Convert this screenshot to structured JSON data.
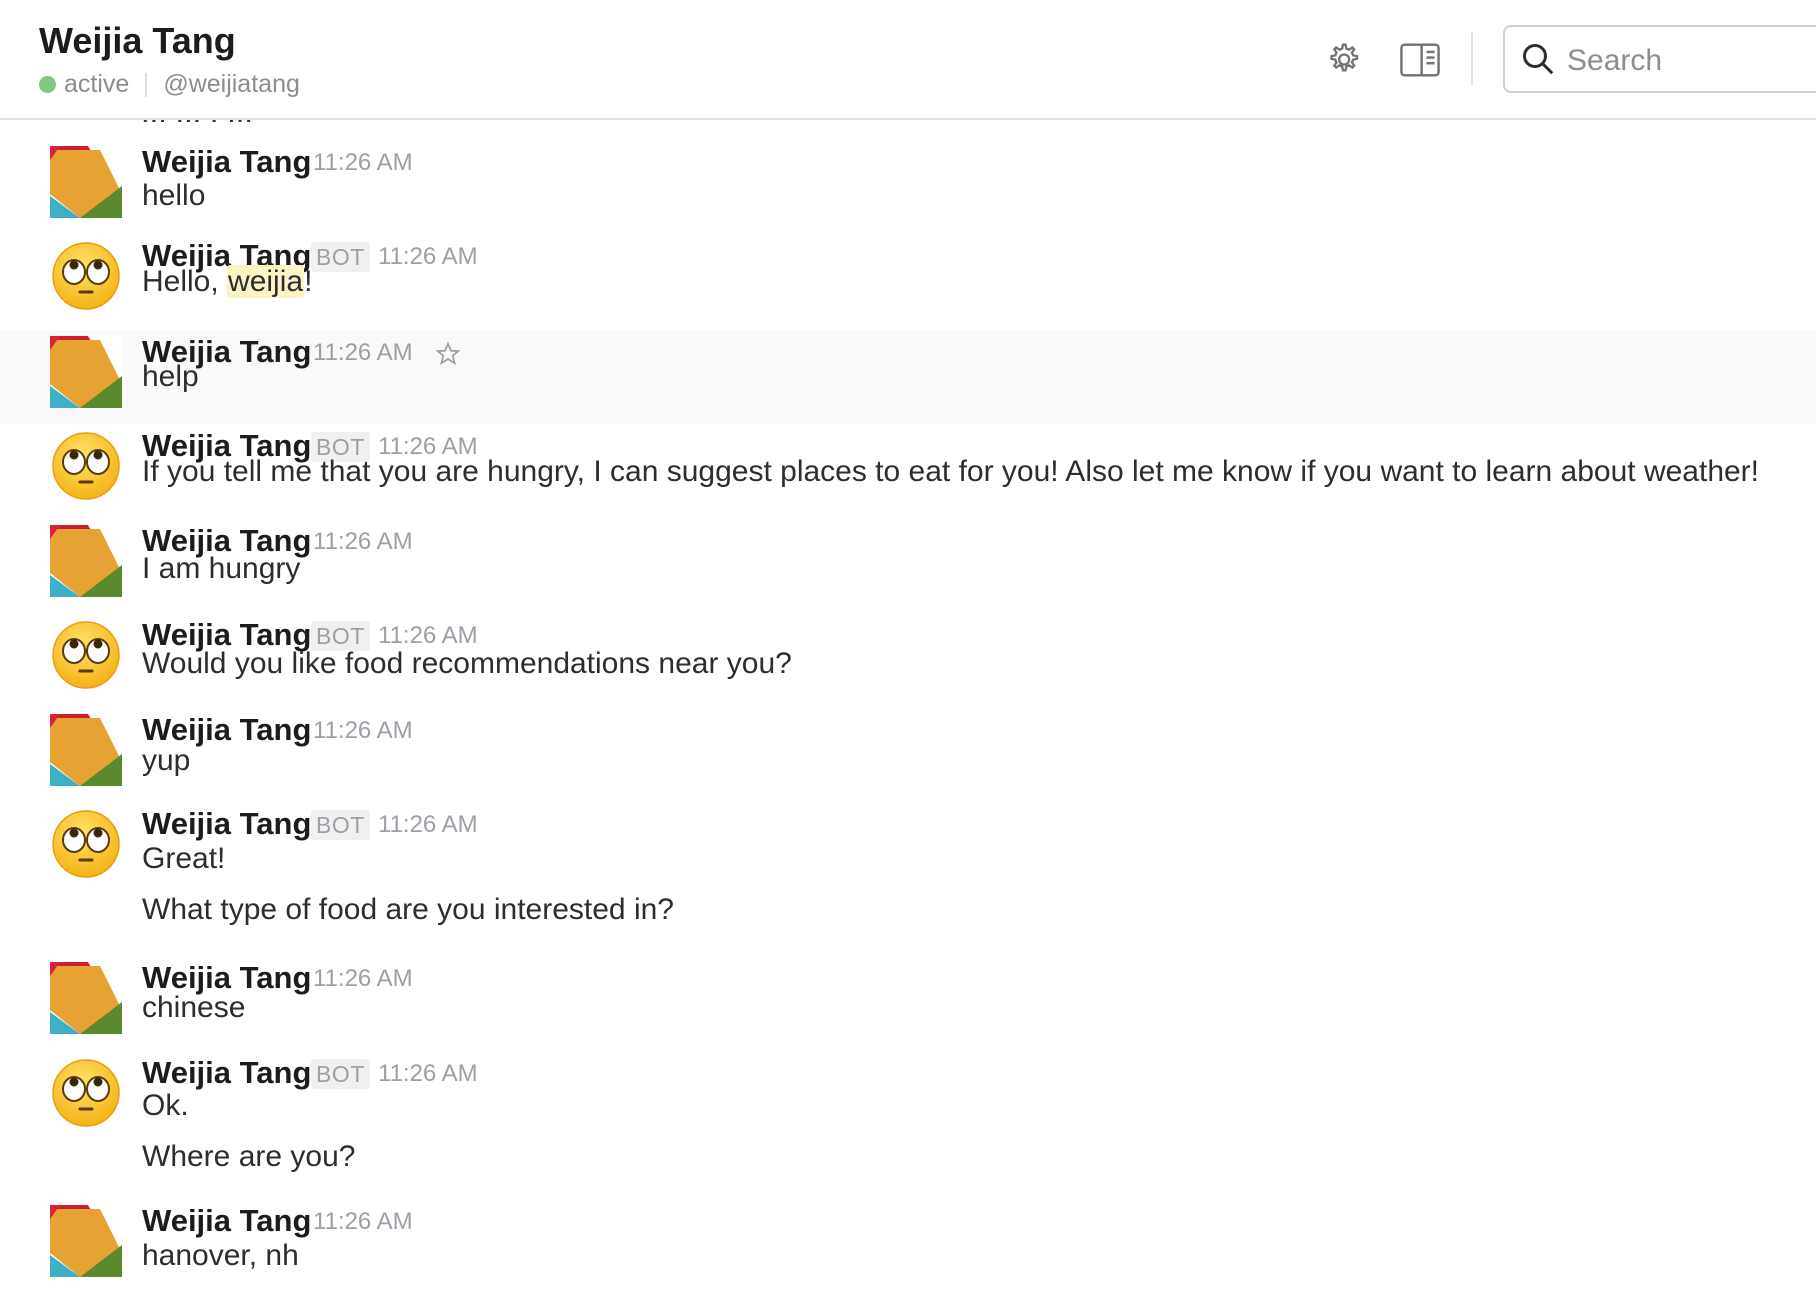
{
  "header": {
    "title": "Weijia Tang",
    "status": "active",
    "handle": "@weijiatang",
    "search_placeholder": "Search",
    "icons": [
      "gear-icon",
      "sidebar-toggle-icon",
      "search-icon"
    ]
  },
  "clipped_text": "... ... . ...",
  "messages": [
    {
      "author": "Weijia Tang",
      "bot": false,
      "time": "11:26 AM",
      "lines": [
        "hello"
      ]
    },
    {
      "author": "Weijia Tang",
      "bot": true,
      "badge": "BOT",
      "time": "11:26 AM",
      "pre": "Hello, ",
      "mention": "weijia",
      "post": "!"
    },
    {
      "author": "Weijia Tang",
      "bot": false,
      "time": "11:26 AM",
      "lines": [
        "help"
      ],
      "hovered": true
    },
    {
      "author": "Weijia Tang",
      "bot": true,
      "badge": "BOT",
      "time": "11:26 AM",
      "lines": [
        "If you tell me that you are hungry, I can suggest places to eat for you! Also let me know if you want to learn about weather!"
      ]
    },
    {
      "author": "Weijia Tang",
      "bot": false,
      "time": "11:26 AM",
      "lines": [
        "I am hungry"
      ]
    },
    {
      "author": "Weijia Tang",
      "bot": true,
      "badge": "BOT",
      "time": "11:26 AM",
      "lines": [
        "Would you like food recommendations near you?"
      ]
    },
    {
      "author": "Weijia Tang",
      "bot": false,
      "time": "11:26 AM",
      "lines": [
        "yup"
      ]
    },
    {
      "author": "Weijia Tang",
      "bot": true,
      "badge": "BOT",
      "time": "11:26 AM",
      "lines": [
        "Great!",
        "What type of food are you interested in?"
      ]
    },
    {
      "author": "Weijia Tang",
      "bot": false,
      "time": "11:26 AM",
      "lines": [
        "chinese"
      ]
    },
    {
      "author": "Weijia Tang",
      "bot": true,
      "badge": "BOT",
      "time": "11:26 AM",
      "lines": [
        "Ok.",
        "Where are you?"
      ]
    },
    {
      "author": "Weijia Tang",
      "bot": false,
      "time": "11:26 AM",
      "lines": [
        "hanover, nh"
      ]
    }
  ]
}
